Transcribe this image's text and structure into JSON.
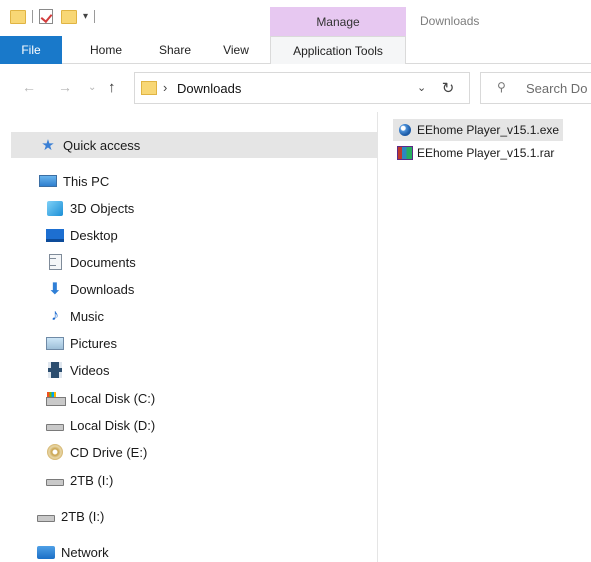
{
  "title_bar": {
    "context_header": "Manage",
    "window_title": "Downloads"
  },
  "ribbon": {
    "tabs": {
      "file": "File",
      "home": "Home",
      "share": "Share",
      "view": "View",
      "app_tools": "Application Tools"
    }
  },
  "address_bar": {
    "path": "Downloads",
    "search_placeholder": "Search Do"
  },
  "nav_pane": {
    "quick_access": "Quick access",
    "this_pc": "This PC",
    "items": {
      "objects3d": "3D Objects",
      "desktop": "Desktop",
      "documents": "Documents",
      "downloads": "Downloads",
      "music": "Music",
      "pictures": "Pictures",
      "videos": "Videos",
      "local_c": "Local Disk (C:)",
      "local_d": "Local Disk (D:)",
      "cd_drive": "CD Drive (E:)",
      "drive_i": "2TB (I:)"
    },
    "drive_i_root": "2TB (I:)",
    "network": "Network"
  },
  "files": [
    {
      "name": "EEhome Player_v15.1.exe",
      "type": "exe",
      "selected": true
    },
    {
      "name": "EEhome Player_v15.1.rar",
      "type": "rar",
      "selected": false
    }
  ],
  "colors": {
    "file_tab": "#1979ca",
    "manage_tab": "#e7c8f1",
    "selection": "#e5e5e5",
    "folder": "#f8d775"
  }
}
